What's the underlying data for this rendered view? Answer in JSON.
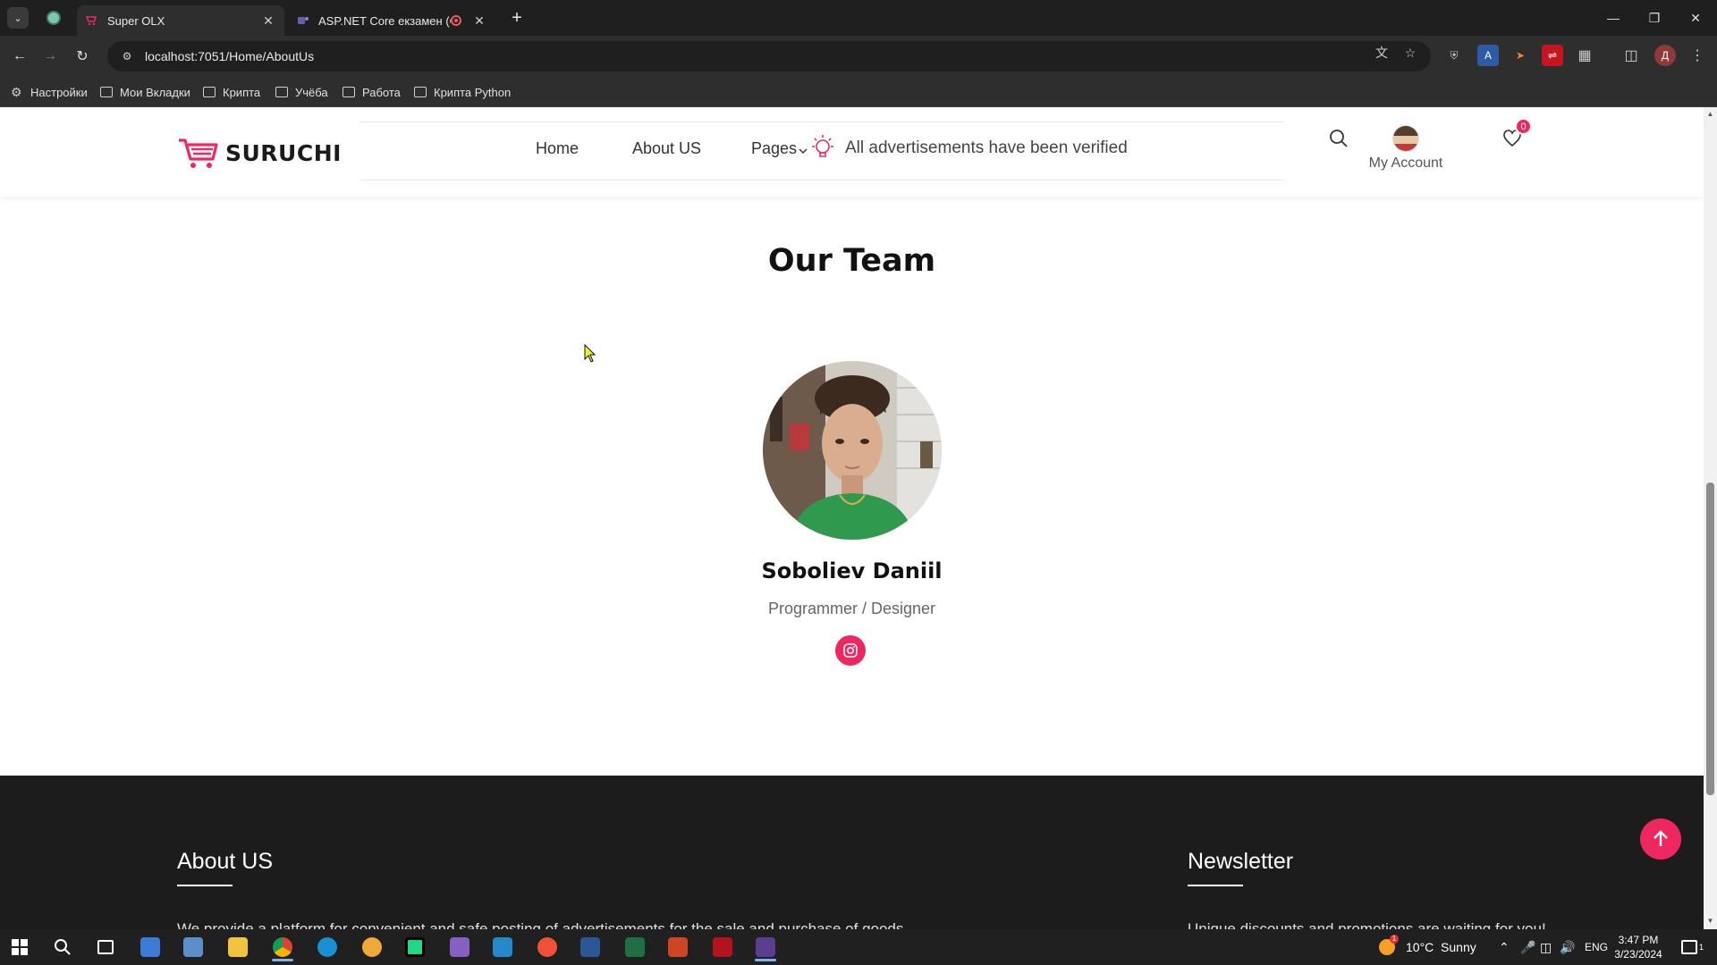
{
  "browser": {
    "tabs": [
      {
        "title": "Super OLX",
        "active": true
      },
      {
        "title": "ASP.NET Core екзамен (Co",
        "active": false
      }
    ],
    "url": "localhost:7051/Home/AboutUs",
    "bookmarks": [
      "Настройки",
      "Мои Вкладки",
      "Крипта",
      "Учёба",
      "Работа",
      "Крипта Python"
    ]
  },
  "site": {
    "logo_text": "SURUCHI",
    "nav": {
      "home": "Home",
      "about": "About US",
      "pages": "Pages"
    },
    "notice": "All advertisements have been verified",
    "account_label": "My Account",
    "wishlist_count": "0",
    "accent_color": "#ee2761"
  },
  "team": {
    "title": "Our Team",
    "members": [
      {
        "name": "Soboliev Daniil",
        "role": "Programmer / Designer"
      }
    ]
  },
  "footer": {
    "about_title": "About US",
    "about_text": "We provide a platform for convenient and safe posting of advertisements for the sale and purchase of goods.",
    "newsletter_title": "Newsletter",
    "newsletter_text": "Unique discounts and promotions are waiting for you!"
  },
  "taskbar": {
    "weather": "10°C  Sunny",
    "weather_badge": "1",
    "lang": "ENG",
    "time": "3:47 PM",
    "date": "3/23/2024",
    "notifications": "1"
  }
}
